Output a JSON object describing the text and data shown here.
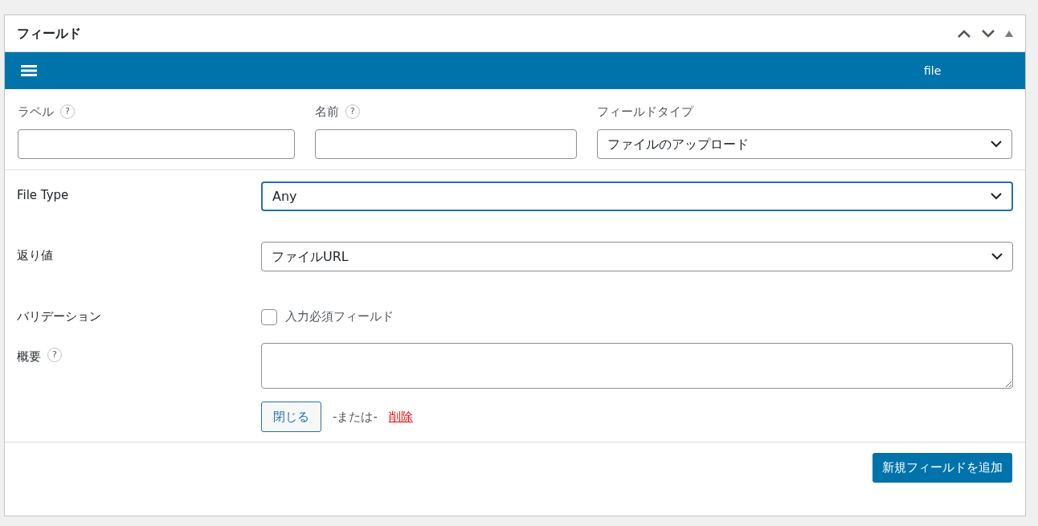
{
  "panel": {
    "title": "フィールド"
  },
  "bar": {
    "field_name": "file"
  },
  "top_fields": [
    {
      "label": "ラベル",
      "help": "?",
      "kind": "text"
    },
    {
      "label": "名前",
      "help": "?",
      "kind": "text"
    },
    {
      "label": "フィールドタイプ",
      "kind": "select",
      "value": "ファイルのアップロード"
    }
  ],
  "rows": [
    {
      "label": "File Type",
      "kind": "select",
      "value": "Any",
      "focused": true
    },
    {
      "label": "返り値",
      "kind": "select",
      "value": "ファイルURL",
      "focused": false
    },
    {
      "label": "バリデーション",
      "kind": "checkbox",
      "option": "入力必須フィールド",
      "checked": false
    },
    {
      "label": "概要",
      "help": "?",
      "kind": "textarea"
    }
  ],
  "actions": {
    "close": "閉じる",
    "or": "-または-",
    "delete": "削除"
  },
  "footer": {
    "add_button": "新規フィールドを追加"
  }
}
